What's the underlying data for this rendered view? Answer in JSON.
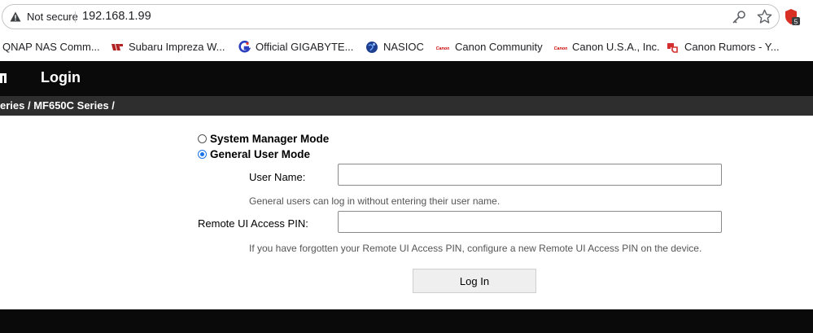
{
  "browser": {
    "security_label": "Not secure",
    "url": "192.168.1.99",
    "extension_badge": "5"
  },
  "bookmarks": [
    {
      "label": "QNAP NAS Comm...",
      "icon": "qnap-icon"
    },
    {
      "label": "Subaru Impreza W...",
      "icon": "subaru-icon"
    },
    {
      "label": "Official GIGABYTE...",
      "icon": "gigabyte-icon"
    },
    {
      "label": "NASIOC",
      "icon": "nasioc-globe-icon"
    },
    {
      "label": "Canon Community",
      "icon": "canon-icon"
    },
    {
      "label": "Canon U.S.A., Inc.",
      "icon": "canon-icon"
    },
    {
      "label": "Canon Rumors - Y...",
      "icon": "canon-rumors-icon"
    }
  ],
  "header": {
    "title": "Login"
  },
  "breadcrumb": {
    "text": "eries / MF650C Series /"
  },
  "login_form": {
    "modes": [
      {
        "label": "System Manager Mode",
        "selected": false
      },
      {
        "label": "General User Mode",
        "selected": true
      }
    ],
    "user_name_label": "User Name:",
    "user_name_value": "",
    "user_name_hint": "General users can log in without entering their user name.",
    "pin_label": "Remote UI Access PIN:",
    "pin_value": "",
    "pin_hint": "If you have forgotten your Remote UI Access PIN, configure a new Remote UI Access PIN on the device.",
    "login_button": "Log In"
  },
  "colors": {
    "header_bg": "#0a0a0a",
    "breadcrumb_bg": "#2e2e2e",
    "radio_accent": "#1a73e8"
  }
}
